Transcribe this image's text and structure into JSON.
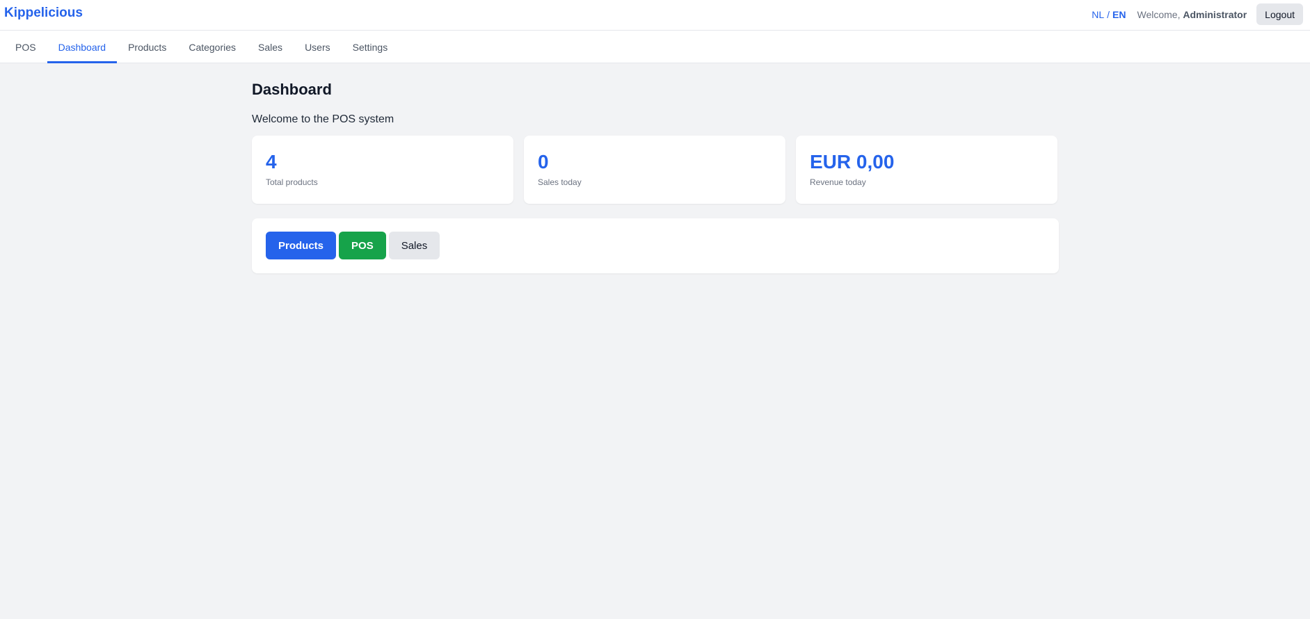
{
  "app": {
    "brand": "Kippelicious"
  },
  "header": {
    "lang_nl": "NL",
    "lang_sep": "/",
    "lang_en": "EN",
    "welcome_prefix": "Welcome,",
    "user_name": "Administrator",
    "logout_label": "Logout"
  },
  "nav": {
    "tabs": [
      {
        "label": "POS"
      },
      {
        "label": "Dashboard",
        "active": true
      },
      {
        "label": "Products"
      },
      {
        "label": "Categories"
      },
      {
        "label": "Sales"
      },
      {
        "label": "Users"
      },
      {
        "label": "Settings"
      }
    ]
  },
  "main": {
    "title": "Dashboard",
    "subtitle": "Welcome to the POS system",
    "stats": [
      {
        "value": "4",
        "label": "Total products"
      },
      {
        "value": "0",
        "label": "Sales today"
      },
      {
        "value": "EUR 0,00",
        "label": "Revenue today"
      }
    ],
    "actions": [
      {
        "label": "Products",
        "color": "#2563eb"
      },
      {
        "label": "POS",
        "color": "#16a34a"
      },
      {
        "label": "Sales",
        "color": "#e5e7eb"
      }
    ]
  },
  "colors": {
    "accent": "#2563eb",
    "success": "#16a34a",
    "background": "#f2f3f5"
  }
}
